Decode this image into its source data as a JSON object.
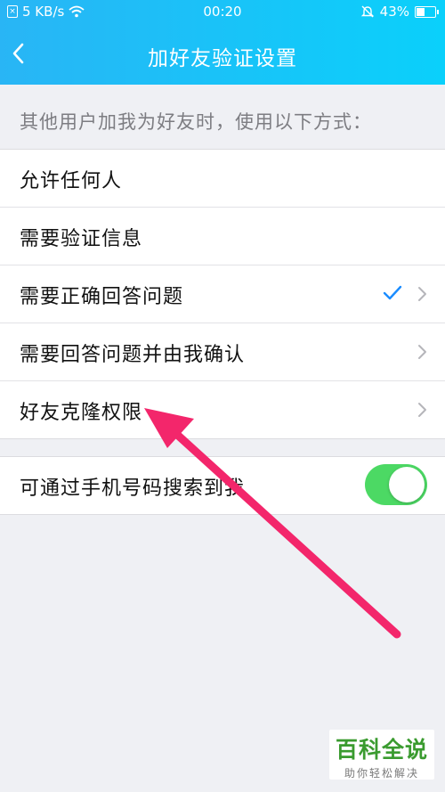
{
  "status_bar": {
    "network_speed": "5 KB/s",
    "time": "00:20",
    "battery_percent": "43%",
    "battery_level": 0.43
  },
  "header": {
    "title": "加好友验证设置"
  },
  "section": {
    "label": "其他用户加我为好友时，使用以下方式："
  },
  "options": [
    {
      "label": "允许任何人"
    },
    {
      "label": "需要验证信息"
    },
    {
      "label": "需要正确回答问题",
      "selected": true
    },
    {
      "label": "需要回答问题并由我确认"
    },
    {
      "label": "好友克隆权限"
    }
  ],
  "phone_search": {
    "label": "可通过手机号码搜索到我",
    "enabled": true
  },
  "colors": {
    "header_start": "#29b5f5",
    "header_end": "#0ad0fb",
    "toggle_on": "#4cd964",
    "check": "#1a8cff",
    "arrow": "#f3266b"
  },
  "watermark": {
    "main": "百科全说",
    "sub": "助你轻松解决"
  }
}
